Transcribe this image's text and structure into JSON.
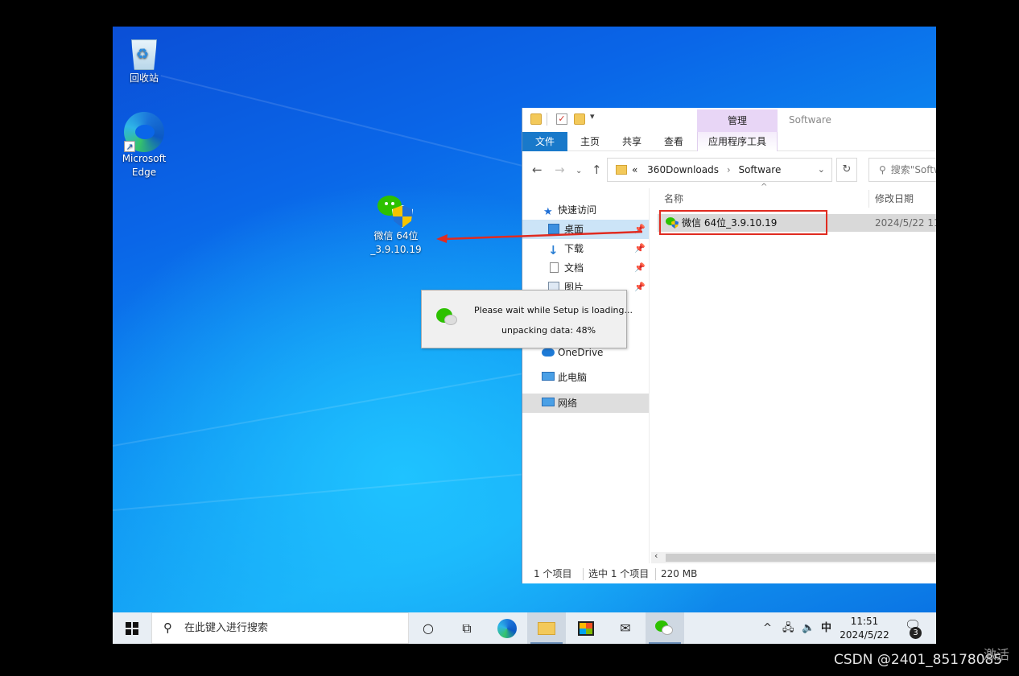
{
  "desktop": {
    "icons": {
      "recycle_bin": "回收站",
      "edge": "Microsoft Edge",
      "wechat_installer_line1": "微信 64位",
      "wechat_installer_line2": "_3.9.10.19"
    }
  },
  "explorer": {
    "context_tab": "管理",
    "context_title": "Software",
    "tabs": {
      "file": "文件",
      "home": "主页",
      "share": "共享",
      "view": "查看",
      "app_tools": "应用程序工具"
    },
    "address": {
      "prefix": "«",
      "segment1": "360Downloads",
      "sep": "›",
      "segment2": "Software"
    },
    "search_placeholder": "搜索\"Software\"",
    "nav": {
      "quick_access": "快速访问",
      "desktop": "桌面",
      "downloads": "下载",
      "documents": "文档",
      "pictures": "图片",
      "onedrive": "OneDrive",
      "this_pc": "此电脑",
      "network": "网络"
    },
    "columns": {
      "name": "名称",
      "modified": "修改日期"
    },
    "file": {
      "name": "微信 64位_3.9.10.19",
      "modified": "2024/5/22 11"
    },
    "status": {
      "count": "1 个项目",
      "selected": "选中 1 个项目",
      "size": "220 MB"
    }
  },
  "setup_dialog": {
    "line1": "Please wait while Setup is loading...",
    "line2": "unpacking data: 48%",
    "progress_percent": 48
  },
  "taskbar": {
    "search_placeholder": "在此键入进行搜索",
    "ime": "中",
    "time": "11:51",
    "date": "2024/5/22",
    "notifications": "3"
  },
  "overlay": {
    "watermark": "CSDN @2401_85178085",
    "activate": "激活"
  },
  "colors": {
    "file_tab": "#1979ca",
    "highlight": "#e02b20",
    "context_tab": "#e8d6f6"
  }
}
